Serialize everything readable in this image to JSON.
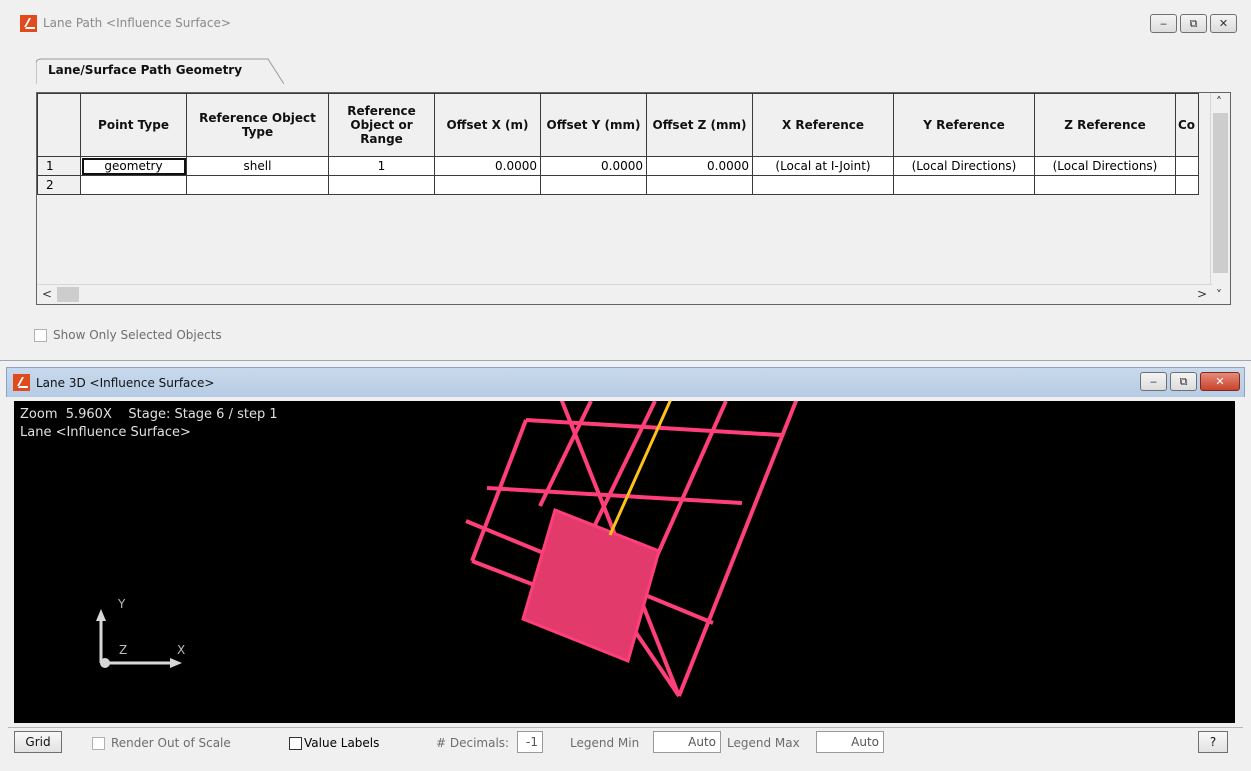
{
  "window1": {
    "title": "Lane Path <Influence Surface>",
    "controls": {
      "minimize": "‒",
      "restore": "⧉",
      "close": "✕"
    },
    "tab": "Lane/Surface Path Geometry",
    "columns": [
      "Point Type",
      "Reference Object Type",
      "Reference Object or Range",
      "Offset X (m)",
      "Offset Y (mm)",
      "Offset Z (mm)",
      "X Reference",
      "Y Reference",
      "Z Reference",
      "Co"
    ],
    "rows": [
      {
        "num": "1",
        "point_type": "geometry",
        "ref_type": "shell",
        "ref_obj": "1",
        "offset_x": "0.0000",
        "offset_y": "0.0000",
        "offset_z": "0.0000",
        "x_ref": "(Local at I-Joint)",
        "y_ref": "(Local Directions)",
        "z_ref": "(Local Directions)"
      },
      {
        "num": "2",
        "point_type": "",
        "ref_type": "",
        "ref_obj": "",
        "offset_x": "",
        "offset_y": "",
        "offset_z": "",
        "x_ref": "",
        "y_ref": "",
        "z_ref": ""
      }
    ],
    "show_only_selected": "Show Only Selected Objects"
  },
  "window2": {
    "title": "Lane 3D <Influence Surface>",
    "controls": {
      "minimize": "‒",
      "restore": "⧉",
      "close": "✕"
    },
    "zoom_line": "Zoom  5.960X    Stage: Stage 6 / step 1",
    "lane_line": "Lane <Influence Surface>",
    "axis": {
      "x": "X",
      "y": "Y",
      "z": "Z"
    },
    "colors": {
      "mesh": "#ff3f7a",
      "highlight": "#e23a6a",
      "lane_path": "#ffc21a",
      "background": "#000000"
    }
  },
  "bottom": {
    "grid_button": "Grid",
    "render_out_of_scale": "Render Out of Scale",
    "value_labels": "Value Labels",
    "decimals_label": "# Decimals:",
    "decimals_value": "-1",
    "legend_min_label": "Legend Min",
    "legend_min_value": "Auto",
    "legend_max_label": "Legend Max",
    "legend_max_value": "Auto",
    "help": "?"
  }
}
